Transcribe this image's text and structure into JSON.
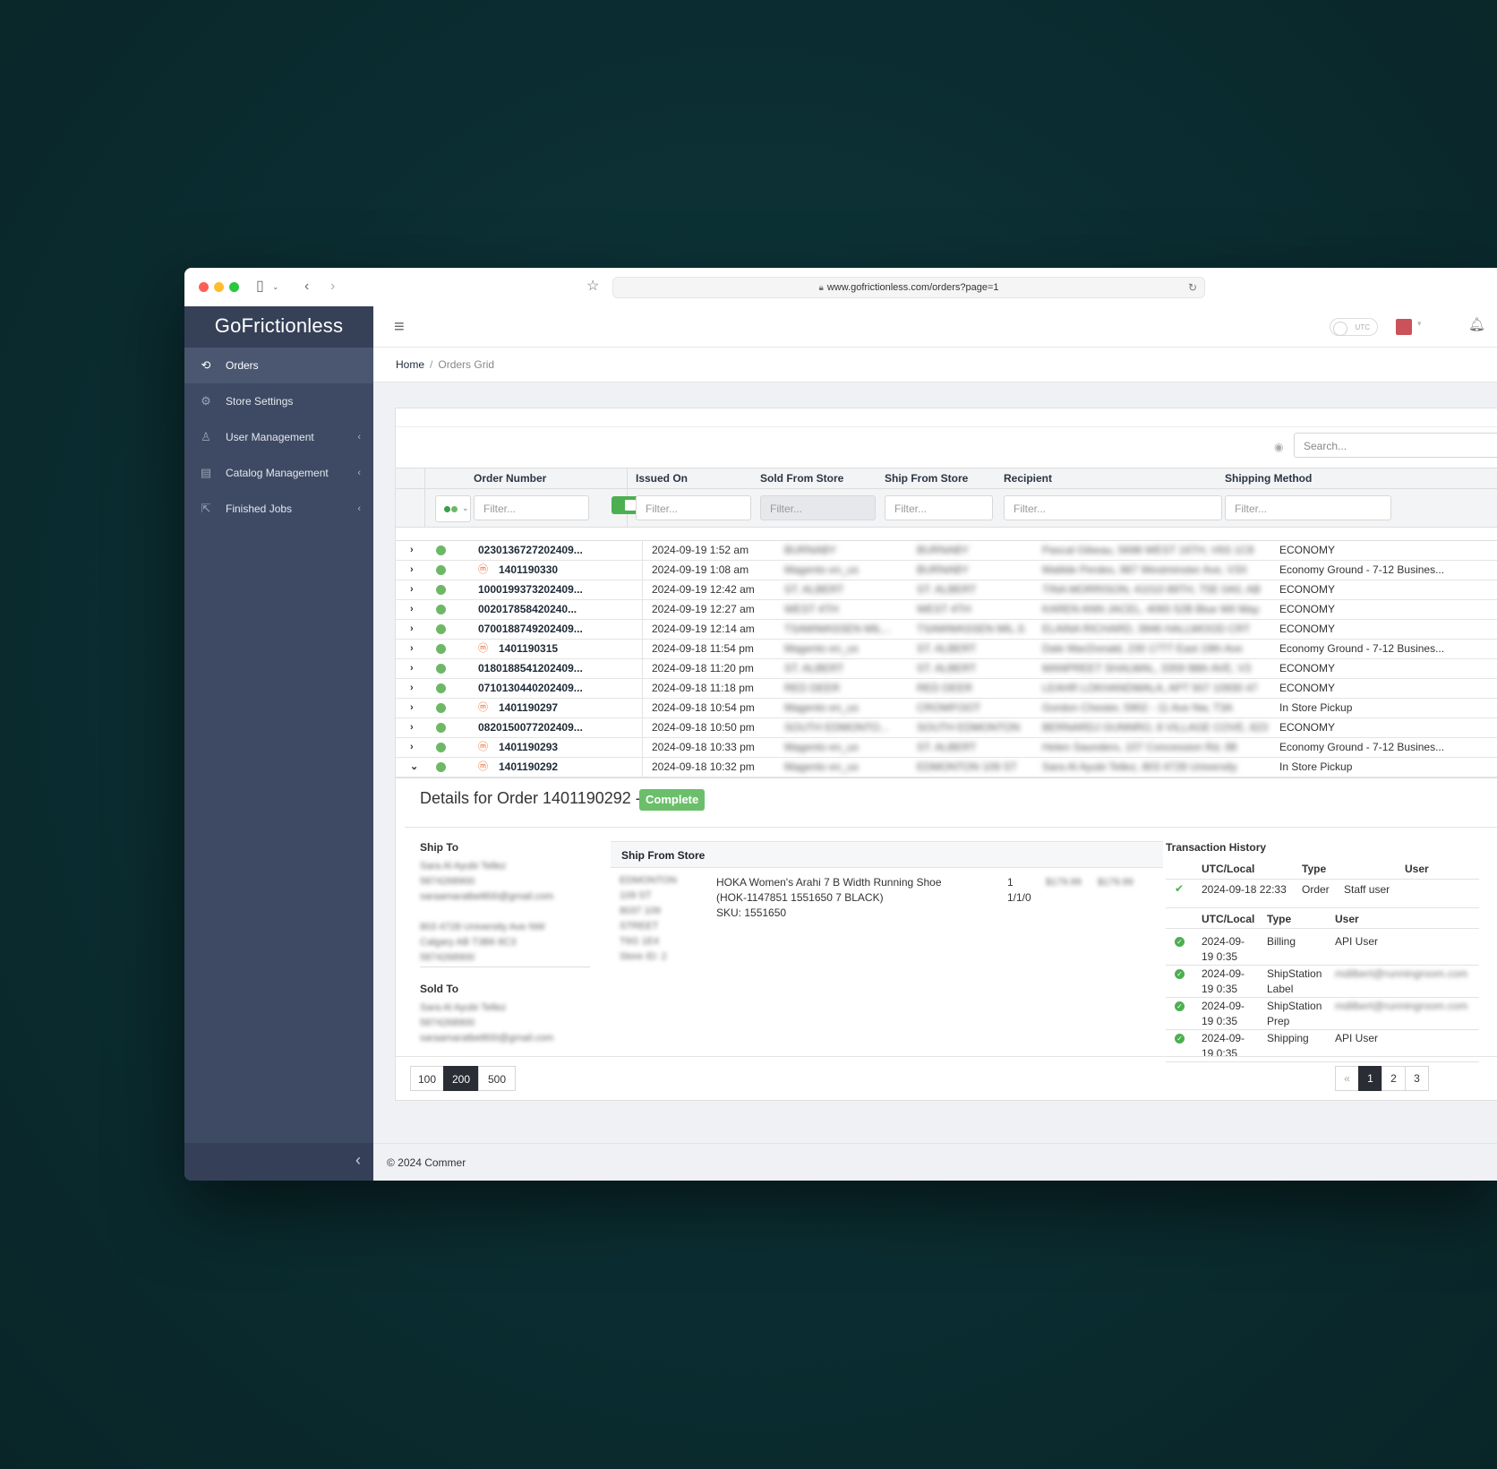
{
  "browser": {
    "url": "www.gofrictionless.com/orders?page=1"
  },
  "sidebar": {
    "brand": "GoFrictionless",
    "items": [
      {
        "label": "Orders",
        "icon": "orders-icon",
        "active": true
      },
      {
        "label": "Store Settings",
        "icon": "gear-icon"
      },
      {
        "label": "User Management",
        "icon": "user-icon",
        "caret": "‹"
      },
      {
        "label": "Catalog Management",
        "icon": "catalog-icon",
        "caret": "‹"
      },
      {
        "label": "Finished Jobs",
        "icon": "external-link-icon",
        "caret": "‹"
      }
    ]
  },
  "topbar": {
    "utc_label": "UTC"
  },
  "breadcrumb": {
    "home": "Home",
    "separator": "/",
    "current": "Orders Grid"
  },
  "grid": {
    "search_placeholder": "Search...",
    "filter_placeholder": "Filter...",
    "columns": [
      "Order Number",
      "Issued On",
      "Sold From Store",
      "Ship From Store",
      "Recipient",
      "Shipping Method"
    ],
    "rows": [
      {
        "order": "0230136727202409...",
        "magento": false,
        "issued": "2024-09-19 1:52 am",
        "sold": "BURNABY",
        "ship": "BURNABY",
        "recipient": "Pascal Gibeau, 5698 WEST 16TH, V6S 1C8",
        "method": "ECONOMY",
        "expand": "›"
      },
      {
        "order": "1401190330",
        "magento": true,
        "issued": "2024-09-19 1:08 am",
        "sold": "Magento en_us",
        "ship": "BURNABY",
        "recipient": "Matilde Perdes, 987 Westminster Ave, V3X",
        "method": "Economy Ground - 7-12 Busines...",
        "expand": "›"
      },
      {
        "order": "1000199373202409...",
        "magento": false,
        "issued": "2024-09-19 12:42 am",
        "sold": "ST. ALBERT",
        "ship": "ST. ALBERT",
        "recipient": "TINA MORRISON, 41010 89TH, T5E 0A0, AB",
        "method": "ECONOMY",
        "expand": "›"
      },
      {
        "order": "002017858420240...",
        "magento": false,
        "issued": "2024-09-19 12:27 am",
        "sold": "WEST 4TH",
        "ship": "WEST 4TH",
        "recipient": "KAREN ANN JACEL, 4065 52B Blue Wil Way",
        "method": "ECONOMY",
        "expand": "›"
      },
      {
        "order": "0700188749202409...",
        "magento": false,
        "issued": "2024-09-19 12:14 am",
        "sold": "TSAWWASSEN MIL...",
        "ship": "TSAWWASSEN MIL.S",
        "recipient": "ELAINA RICHARD, 3946 HALLWOOD CRT",
        "method": "ECONOMY",
        "expand": "›"
      },
      {
        "order": "1401190315",
        "magento": true,
        "issued": "2024-09-18 11:54 pm",
        "sold": "Magento en_us",
        "ship": "ST. ALBERT",
        "recipient": "Dale MacDonald, 230 17TT East 19th Ave",
        "method": "Economy Ground - 7-12 Busines...",
        "expand": "›"
      },
      {
        "order": "0180188541202409...",
        "magento": false,
        "issued": "2024-09-18 11:20 pm",
        "sold": "ST. ALBERT",
        "ship": "ST. ALBERT",
        "recipient": "MANPREET SHALWAL, 3359 98th AVE, V3",
        "method": "ECONOMY",
        "expand": "›"
      },
      {
        "order": "0710130440202409...",
        "magento": false,
        "issued": "2024-09-18 11:18 pm",
        "sold": "RED DEER",
        "ship": "RED DEER",
        "recipient": "LEAHR LOKHANDWALA, APT 507 10930 47",
        "method": "ECONOMY",
        "expand": "›"
      },
      {
        "order": "1401190297",
        "magento": true,
        "issued": "2024-09-18 10:54 pm",
        "sold": "Magento en_us",
        "ship": "CROWFOOT",
        "recipient": "Gordon Chester, 5902 - 11 Ave Nw, T3A",
        "method": "In Store Pickup",
        "expand": "›"
      },
      {
        "order": "0820150077202409...",
        "magento": false,
        "issued": "2024-09-18 10:50 pm",
        "sold": "SOUTH EDMONTO...",
        "ship": "SOUTH EDMONTON",
        "recipient": "BERNARDJ GUNNRO, 8 VILLAGE COVE, 823",
        "method": "ECONOMY",
        "expand": "›"
      },
      {
        "order": "1401190293",
        "magento": true,
        "issued": "2024-09-18 10:33 pm",
        "sold": "Magento en_us",
        "ship": "ST. ALBERT",
        "recipient": "Helen Saunders, 107 Concession Rd, 98",
        "method": "Economy Ground - 7-12 Busines...",
        "expand": "›"
      },
      {
        "order": "1401190292",
        "magento": true,
        "issued": "2024-09-18 10:32 pm",
        "sold": "Magento en_us",
        "ship": "EDMONTON 109 ST",
        "recipient": "Sara Al Ayubi Tellez, 803 4728 University",
        "method": "In Store Pickup",
        "expand": "⌄"
      }
    ]
  },
  "details": {
    "title": "Details for Order 1401190292 -",
    "status": "Complete",
    "ship_to_label": "Ship To",
    "ship_to_lines": [
      "Sara Al Ayubi Tellez",
      "5874268900",
      "saraamaratbeltl00@gmail.com",
      "",
      "803 4728 University Ave NW",
      "Calgary AB T3B6 8C3",
      "5874268900"
    ],
    "sold_to_label": "Sold To",
    "sold_to_lines": [
      "Sara Al Ayubi Tellez",
      "5874268900",
      "saraamaratbeltl00@gmail.com"
    ],
    "ship_from_label": "Ship From Store",
    "ship_from_lines": [
      "EDMONTON",
      "109 ST",
      "8037 109",
      "STREET",
      "T6G 1E4",
      "Store ID: 2"
    ],
    "item_desc": "HOKA Women's Arahi 7 B Width Running Shoe (HOK-1147851 1551650 7 BLACK)",
    "item_sku": "SKU: 1551650",
    "item_qty": "1",
    "item_qty2": "1/1/0",
    "item_price": "$179.99",
    "item_total": "$179.99"
  },
  "transactions": {
    "title": "Transaction History",
    "table1_headers": [
      "UTC/Local",
      "Type",
      "User"
    ],
    "table1_rows": [
      {
        "time": "2024-09-18 22:33",
        "type": "Order",
        "user": "Staff user"
      }
    ],
    "table2_headers": [
      "UTC/Local",
      "Type",
      "User"
    ],
    "table2_rows": [
      {
        "time1": "2024-09-",
        "time2": "19 0:35",
        "type1": "Billing",
        "type2": "",
        "user": "API User",
        "blur": false
      },
      {
        "time1": "2024-09-",
        "time2": "19 0:35",
        "type1": "ShipStation",
        "type2": "Label",
        "user": "mdilbert@runningroom.com",
        "blur": true
      },
      {
        "time1": "2024-09-",
        "time2": "19 0:35",
        "type1": "ShipStation",
        "type2": "Prep",
        "user": "mdilbert@runningroom.com",
        "blur": true
      },
      {
        "time1": "2024-09-",
        "time2": "19 0:35",
        "type1": "Shipping",
        "type2": "",
        "user": "API User",
        "blur": false
      }
    ]
  },
  "pager": {
    "sizes": [
      "100",
      "200",
      "500"
    ],
    "active_size": "200",
    "prev": "«",
    "pages": [
      "1",
      "2",
      "3"
    ],
    "active_page": "1"
  },
  "footer": {
    "text": "© 2024 Commer"
  },
  "colors": {
    "sidebar": "#3e4a63",
    "status_green": "#6db865",
    "badge_green": "#6bbf6b",
    "magento_orange": "#e8642a"
  }
}
